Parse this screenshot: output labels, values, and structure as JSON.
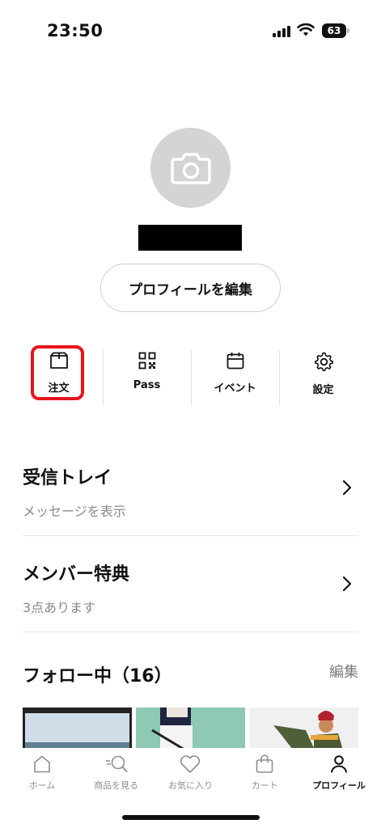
{
  "status_bar": {
    "time": "23:50",
    "battery": "63",
    "icons": [
      "signal-icon",
      "wifi-icon",
      "battery-icon"
    ]
  },
  "profile": {
    "avatar_icon": "camera-icon",
    "edit_button": "プロフィールを編集"
  },
  "quick_actions": [
    {
      "label": "注文",
      "icon": "box-icon"
    },
    {
      "label": "Pass",
      "icon": "qr-code-icon"
    },
    {
      "label": "イベント",
      "icon": "calendar-icon"
    },
    {
      "label": "設定",
      "icon": "gear-icon"
    }
  ],
  "menu": [
    {
      "title": "受信トレイ",
      "subtitle": "メッセージを表示"
    },
    {
      "title": "メンバー特典",
      "subtitle": "3点あります"
    }
  ],
  "follow": {
    "title": "フォロー中（16）",
    "edit": "編集"
  },
  "tabbar": [
    {
      "label": "ホーム",
      "icon": "home-icon",
      "active": false
    },
    {
      "label": "商品を見る",
      "icon": "search-icon",
      "active": false
    },
    {
      "label": "お気に入り",
      "icon": "heart-icon",
      "active": false
    },
    {
      "label": "カート",
      "icon": "bag-icon",
      "active": false
    },
    {
      "label": "プロフィール",
      "icon": "person-icon",
      "active": true
    }
  ],
  "colors": {
    "highlight": "#e8141b",
    "avatar_bg": "#d4d4d4",
    "muted_text": "#8a8a8a"
  }
}
